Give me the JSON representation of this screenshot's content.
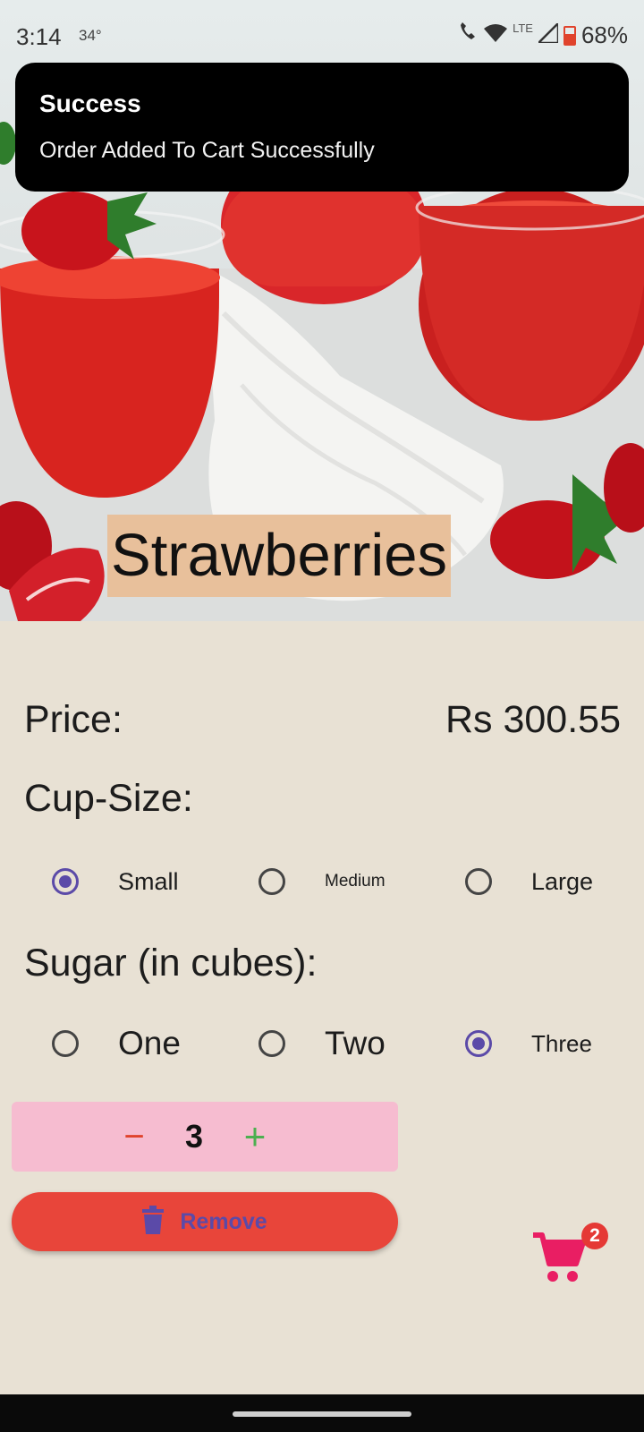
{
  "status_bar": {
    "time": "3:14",
    "temperature": "34°",
    "network": "LTE",
    "battery": "68%"
  },
  "toast": {
    "title": "Success",
    "message": "Order Added To Cart Successfully"
  },
  "product": {
    "title": "Strawberries",
    "price_label": "Price:",
    "price_value": "Rs 300.55"
  },
  "cup_size": {
    "label": "Cup-Size:",
    "options": [
      "Small",
      "Medium",
      "Large"
    ],
    "selected": "Small"
  },
  "sugar": {
    "label": "Sugar (in cubes):",
    "options": [
      "One",
      "Two",
      "Three"
    ],
    "selected": "Three"
  },
  "quantity": {
    "minus_symbol": "−",
    "value": "3",
    "plus_symbol": "+"
  },
  "remove_button": {
    "label": "Remove",
    "icon": "trash-icon"
  },
  "cart": {
    "icon": "cart-icon",
    "badge_count": "2"
  },
  "colors": {
    "background": "#e8e1d4",
    "accent": "#5b4aa8",
    "remove_button": "#e8453a",
    "quantity_box": "#f6bcd0",
    "title_highlight": "#e8c09b",
    "cart": "#e91e63"
  }
}
